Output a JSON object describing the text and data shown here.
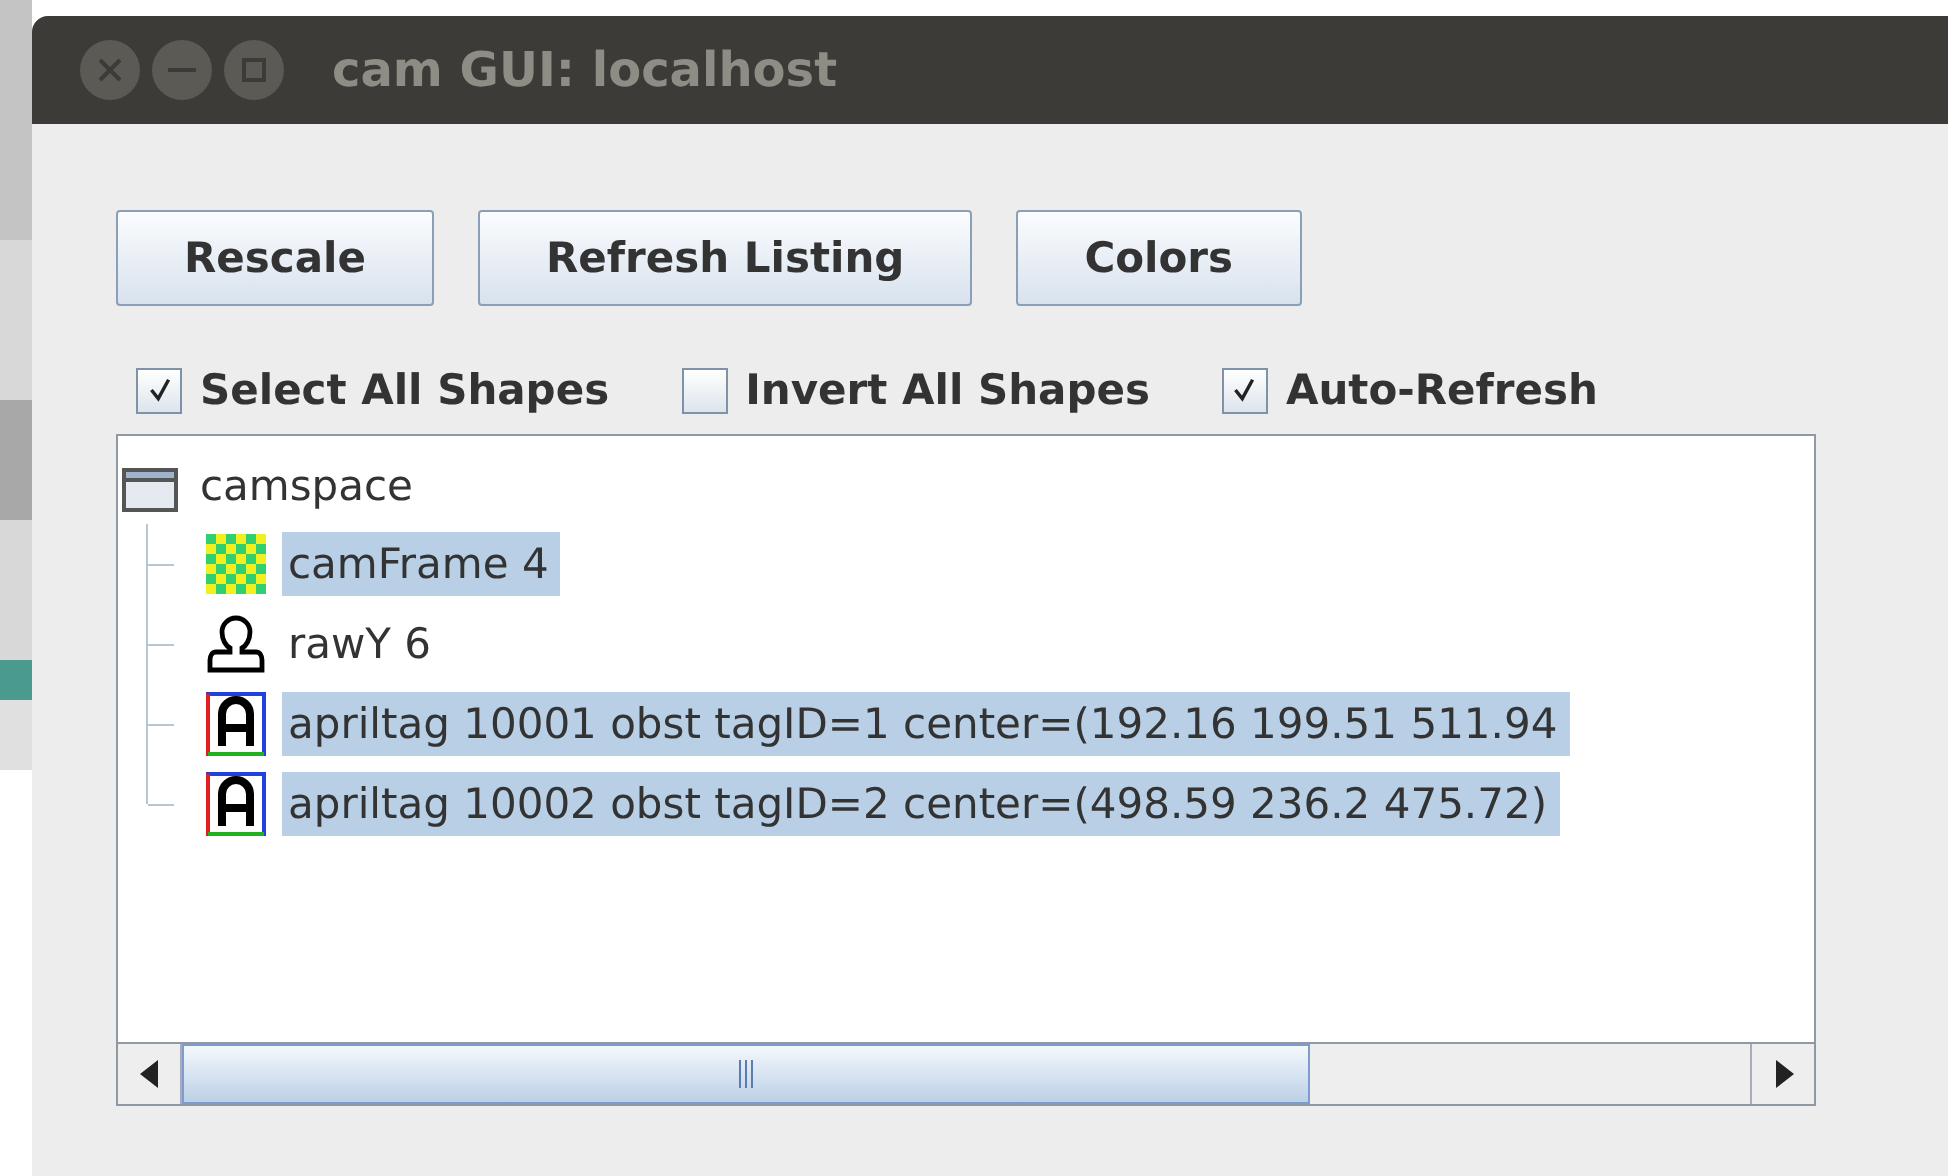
{
  "window": {
    "title": "cam GUI: localhost"
  },
  "buttons": [
    "Rescale",
    "Refresh Listing",
    "Colors"
  ],
  "options": [
    {
      "label": "Select All Shapes",
      "checked": true
    },
    {
      "label": "Invert All Shapes",
      "checked": false
    },
    {
      "label": "Auto-Refresh",
      "checked": true
    }
  ],
  "tree": {
    "root": {
      "label": "camspace",
      "expanded": true,
      "children": [
        {
          "kind": "frame",
          "label": "camFrame 4",
          "selected": true
        },
        {
          "kind": "sketch",
          "label": "rawY 6",
          "selected": false
        },
        {
          "kind": "apriltag",
          "label": "apriltag 10001 obst tagID=1 center=(192.16 199.51 511.94",
          "selected": true
        },
        {
          "kind": "apriltag",
          "label": "apriltag 10002 obst tagID=2 center=(498.59 236.2 475.72)",
          "selected": true
        }
      ]
    }
  }
}
